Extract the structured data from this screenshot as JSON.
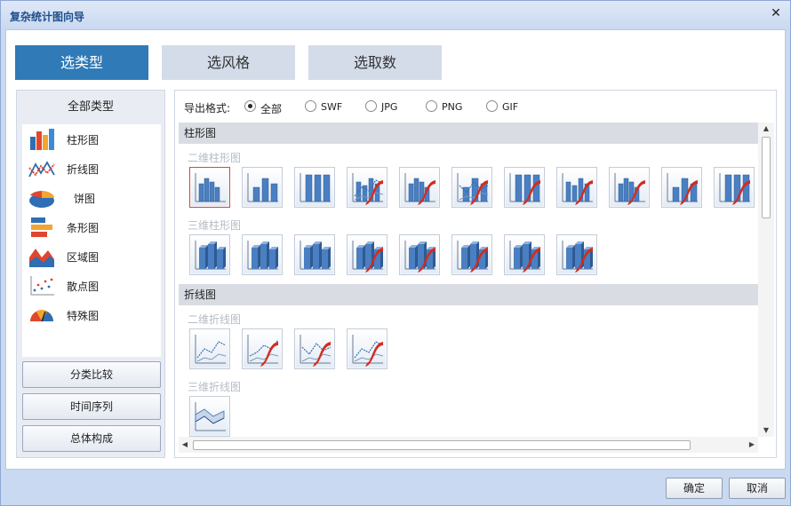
{
  "window": {
    "title": "复杂统计图向导",
    "close_symbol": "✕"
  },
  "steps": [
    {
      "label": "选类型",
      "active": true
    },
    {
      "label": "选风格",
      "active": false
    },
    {
      "label": "选取数",
      "active": false
    }
  ],
  "left_panel": {
    "header": "全部类型",
    "types": [
      {
        "label": "柱形图",
        "icon": "bar-chart-icon"
      },
      {
        "label": "折线图",
        "icon": "line-chart-icon"
      },
      {
        "label": "饼图",
        "icon": "pie-chart-icon"
      },
      {
        "label": "条形图",
        "icon": "horizontal-bar-chart-icon"
      },
      {
        "label": "区域图",
        "icon": "area-chart-icon"
      },
      {
        "label": "散点图",
        "icon": "scatter-chart-icon"
      },
      {
        "label": "特殊图",
        "icon": "gauge-chart-icon"
      }
    ],
    "buttons": [
      "分类比较",
      "时间序列",
      "总体构成"
    ]
  },
  "export": {
    "label": "导出格式:",
    "options": [
      {
        "label": "全部",
        "checked": true
      },
      {
        "label": "SWF",
        "checked": false
      },
      {
        "label": "JPG",
        "checked": false
      },
      {
        "label": "PNG",
        "checked": false
      },
      {
        "label": "GIF",
        "checked": false
      }
    ]
  },
  "gallery": {
    "sections": [
      {
        "title": "柱形图",
        "groups": [
          {
            "title": "二维柱形图",
            "count": 11
          },
          {
            "title": "三维柱形图",
            "count": 8
          }
        ]
      },
      {
        "title": "折线图",
        "groups": [
          {
            "title": "二维折线图",
            "count": 4
          },
          {
            "title": "三维折线图",
            "count": 1
          }
        ]
      }
    ]
  },
  "footer": {
    "ok": "确定",
    "cancel": "取消"
  },
  "colors": {
    "accent": "#2f7ab7",
    "bar": "#4a7fc1",
    "flash": "#d42b1e",
    "selected_border": "#d34a3a"
  }
}
